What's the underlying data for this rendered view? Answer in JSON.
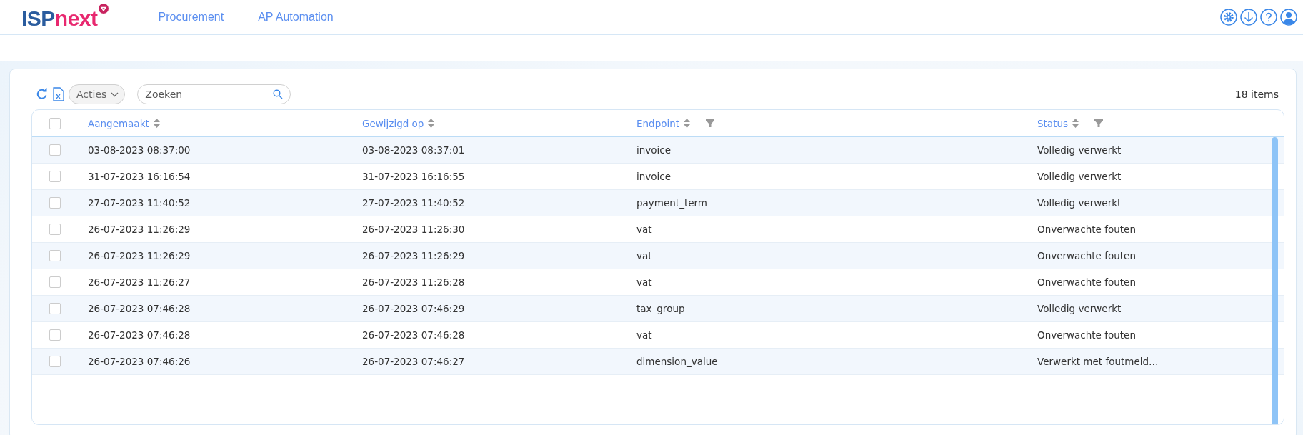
{
  "header": {
    "logo": {
      "part_1": "ISP",
      "part_2": "next"
    },
    "nav": [
      {
        "label": "Procurement"
      },
      {
        "label": "AP Automation"
      }
    ]
  },
  "toolbar": {
    "actions_button": "Acties",
    "search": {
      "placeholder": "Zoeken"
    },
    "item_count": "18 items"
  },
  "table": {
    "all_selected": false,
    "columns": [
      {
        "label": "Aangemaakt",
        "filterable": false
      },
      {
        "label": "Gewijzigd op",
        "filterable": false
      },
      {
        "label": "Endpoint",
        "filterable": true
      },
      {
        "label": "Status",
        "filterable": true
      }
    ],
    "rows": [
      {
        "cells": [
          "03-08-2023 08:37:00",
          "03-08-2023 08:37:01",
          "invoice",
          "Volledig verwerkt"
        ],
        "checked": false
      },
      {
        "cells": [
          "31-07-2023 16:16:54",
          "31-07-2023 16:16:55",
          "invoice",
          "Volledig verwerkt"
        ],
        "checked": false
      },
      {
        "cells": [
          "27-07-2023 11:40:52",
          "27-07-2023 11:40:52",
          "payment_term",
          "Volledig verwerkt"
        ],
        "checked": false
      },
      {
        "cells": [
          "26-07-2023 11:26:29",
          "26-07-2023 11:26:30",
          "vat",
          "Onverwachte fouten"
        ],
        "checked": false
      },
      {
        "cells": [
          "26-07-2023 11:26:29",
          "26-07-2023 11:26:29",
          "vat",
          "Onverwachte fouten"
        ],
        "checked": false
      },
      {
        "cells": [
          "26-07-2023 11:26:27",
          "26-07-2023 11:26:28",
          "vat",
          "Onverwachte fouten"
        ],
        "checked": false
      },
      {
        "cells": [
          "26-07-2023 07:46:28",
          "26-07-2023 07:46:29",
          "tax_group",
          "Volledig verwerkt"
        ],
        "checked": false
      },
      {
        "cells": [
          "26-07-2023 07:46:28",
          "26-07-2023 07:46:28",
          "vat",
          "Onverwachte fouten"
        ],
        "checked": false
      },
      {
        "cells": [
          "26-07-2023 07:46:26",
          "26-07-2023 07:46:27",
          "dimension_value",
          "Verwerkt met foutmeld…"
        ],
        "checked": false
      }
    ]
  }
}
